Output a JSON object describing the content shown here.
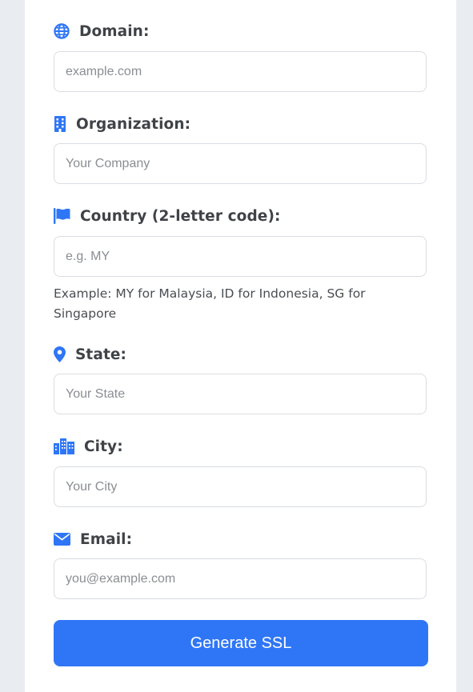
{
  "form": {
    "domain": {
      "label": "Domain:",
      "placeholder": "example.com",
      "icon": "globe-icon"
    },
    "organization": {
      "label": "Organization:",
      "placeholder": "Your Company",
      "icon": "building-icon"
    },
    "country": {
      "label": "Country (2-letter code):",
      "placeholder": "e.g. MY",
      "icon": "flag-icon",
      "hint": "Example: MY for Malaysia, ID for Indonesia, SG for Singapore"
    },
    "state": {
      "label": "State:",
      "placeholder": "Your State",
      "icon": "map-marker-icon"
    },
    "city": {
      "label": "City:",
      "placeholder": "Your City",
      "icon": "city-icon"
    },
    "email": {
      "label": "Email:",
      "placeholder": "you@example.com",
      "icon": "envelope-icon"
    },
    "submit_label": "Generate SSL"
  },
  "colors": {
    "accent": "#2f76f6",
    "icon": "#2f76f6",
    "label_text": "#3f4347",
    "page_background": "#e9edf2",
    "card_background": "#ffffff"
  }
}
